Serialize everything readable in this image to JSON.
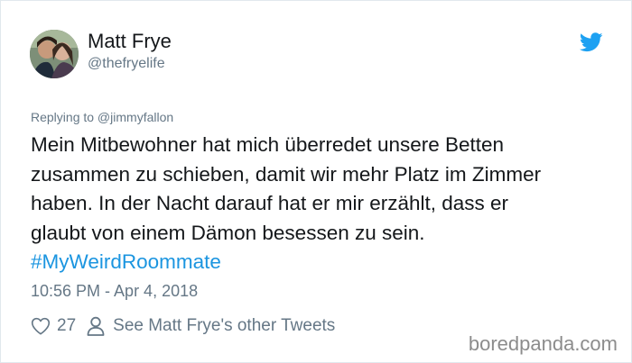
{
  "author": {
    "name": "Matt Frye",
    "handle": "@thefryelife"
  },
  "icons": {
    "brand": "twitter-bird-icon",
    "like": "heart-icon",
    "profile": "person-icon"
  },
  "tweet": {
    "replying_to": "Replying to @jimmyfallon",
    "text_lines": [
      "Mein Mitbewohner hat mich überredet unsere Betten",
      "zusammen zu schieben, damit wir mehr Platz im Zimmer",
      "haben. In der Nacht darauf hat er mir erzählt, dass er",
      "glaubt von einem Dämon besessen zu sein."
    ],
    "hashtag": "#MyWeirdRoommate",
    "timestamp": "10:56 PM - Apr 4, 2018"
  },
  "actions": {
    "like_count": "27",
    "other_tweets_label": "See Matt Frye's other Tweets"
  },
  "watermark": "boredpanda.com",
  "colors": {
    "text": "#14171a",
    "secondary": "#657786",
    "link": "#1b95e0",
    "brand_blue": "#1da1f2"
  }
}
